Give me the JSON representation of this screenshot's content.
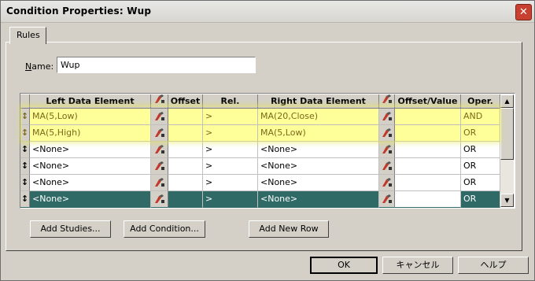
{
  "window": {
    "title": "Condition Properties: Wup",
    "close_glyph": "✕"
  },
  "tabs": [
    {
      "label": "Rules"
    }
  ],
  "name_field": {
    "label": "Name:",
    "value": "Wup"
  },
  "grid": {
    "columns": {
      "left": "Left Data Element",
      "offset": "Offset",
      "rel": "Rel.",
      "right": "Right Data Element",
      "offset_value": "Offset/Value",
      "oper": "Oper."
    },
    "rows": [
      {
        "left": "MA(5,Low)",
        "rel": ">",
        "right": "MA(20,Close)",
        "offset_value": "",
        "oper": "AND"
      },
      {
        "left": "MA(5,High)",
        "rel": ">",
        "right": "MA(5,Low)",
        "offset_value": "",
        "oper": "OR"
      },
      {
        "left": "<None>",
        "rel": ">",
        "right": "<None>",
        "offset_value": "",
        "oper": "OR"
      },
      {
        "left": "<None>",
        "rel": ">",
        "right": "<None>",
        "offset_value": "",
        "oper": "OR"
      },
      {
        "left": "<None>",
        "rel": ">",
        "right": "<None>",
        "offset_value": "",
        "oper": "OR"
      },
      {
        "left": "<None>",
        "rel": ">",
        "right": "<None>",
        "offset_value": "",
        "oper": "OR"
      }
    ],
    "row_handle_glyph": "↕",
    "icons": {
      "picker": "data-picker-icon",
      "scroll_up": "▲",
      "scroll_down": "▼"
    }
  },
  "buttons": {
    "add_studies": "Add Studies...",
    "add_condition": "Add Condition...",
    "add_new_row": "Add New Row",
    "ok": "OK",
    "cancel": "キャンセル",
    "help": "ヘルプ"
  },
  "colors": {
    "highlight_row": "#ffff99",
    "selected_row": "#2f6a66",
    "close_button": "#c8402f"
  }
}
